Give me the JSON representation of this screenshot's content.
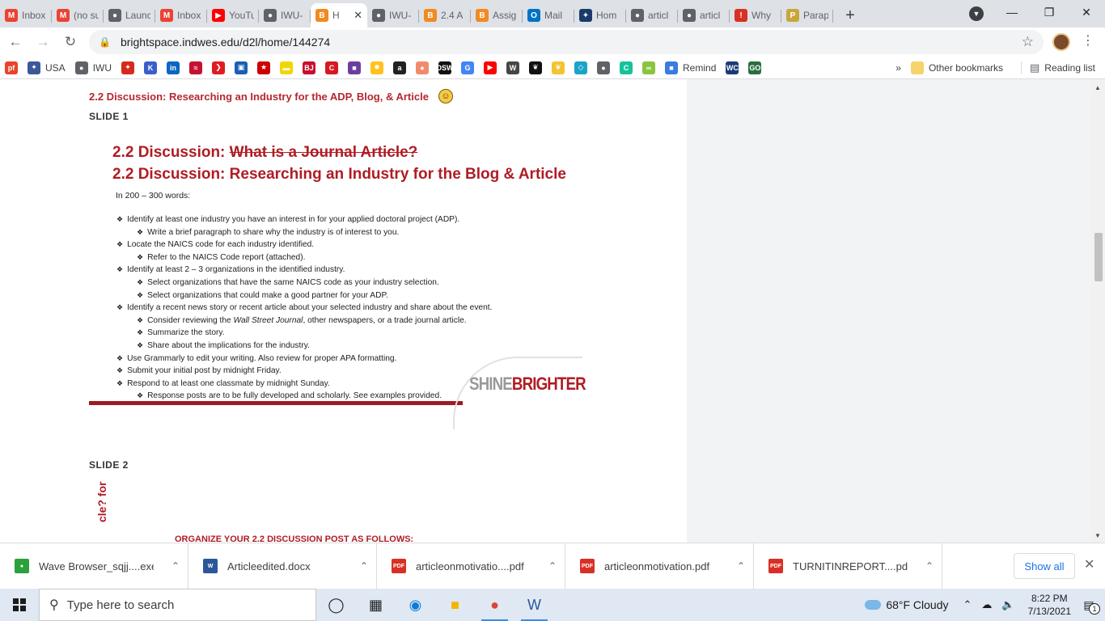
{
  "browser": {
    "tabs": [
      {
        "title": "Inbox",
        "icon": "gmail-icon",
        "color": "#ea4335",
        "glyph": "M"
      },
      {
        "title": "(no su",
        "icon": "gmail-icon",
        "color": "#ea4335",
        "glyph": "M"
      },
      {
        "title": "Launc",
        "icon": "globe-icon",
        "color": "#5f6368",
        "glyph": "●"
      },
      {
        "title": "Inbox",
        "icon": "gmail-icon",
        "color": "#ea4335",
        "glyph": "M"
      },
      {
        "title": "YouTu",
        "icon": "youtube-icon",
        "color": "#ff0000",
        "glyph": "▶"
      },
      {
        "title": "IWU-",
        "icon": "globe-icon",
        "color": "#5f6368",
        "glyph": "●"
      },
      {
        "title": "H",
        "icon": "brightspace-icon",
        "color": "#f18a21",
        "glyph": "B",
        "active": true
      },
      {
        "title": "IWU-",
        "icon": "globe-icon",
        "color": "#5f6368",
        "glyph": "●"
      },
      {
        "title": "2.4 A",
        "icon": "brightspace-icon",
        "color": "#f18a21",
        "glyph": "B"
      },
      {
        "title": "Assig",
        "icon": "brightspace-icon",
        "color": "#f18a21",
        "glyph": "B"
      },
      {
        "title": "Mail",
        "icon": "outlook-icon",
        "color": "#0072c6",
        "glyph": "O"
      },
      {
        "title": "Hom",
        "icon": "compass-icon",
        "color": "#1a3a6b",
        "glyph": "✦"
      },
      {
        "title": "articl",
        "icon": "globe-icon",
        "color": "#5f6368",
        "glyph": "●"
      },
      {
        "title": "articl",
        "icon": "globe-icon",
        "color": "#5f6368",
        "glyph": "●"
      },
      {
        "title": "Why",
        "icon": "exclaim-icon",
        "color": "#d93025",
        "glyph": "!"
      },
      {
        "title": "Parap",
        "icon": "quillbot-icon",
        "color": "#c8a63a",
        "glyph": "P"
      }
    ],
    "url": "brightspace.indwes.edu/d2l/home/144274",
    "bookmarks": [
      {
        "label": "",
        "icon": "pf-icon",
        "color": "#e8452c",
        "glyph": "pf"
      },
      {
        "label": "USA",
        "icon": "seal-icon",
        "color": "#3b5998",
        "glyph": "✦"
      },
      {
        "label": "IWU",
        "icon": "globe-icon",
        "color": "#5f6368",
        "glyph": "●"
      },
      {
        "label": "",
        "icon": "maple-leaf-icon",
        "color": "#d52b1e",
        "glyph": "✦"
      },
      {
        "label": "",
        "icon": "k-icon",
        "color": "#3a5fcd",
        "glyph": "K"
      },
      {
        "label": "",
        "icon": "linkedin-icon",
        "color": "#0a66c2",
        "glyph": "in"
      },
      {
        "label": "",
        "icon": "bank-icon",
        "color": "#c41230",
        "glyph": "≈"
      },
      {
        "label": "",
        "icon": "arrow-icon",
        "color": "#e11b22",
        "glyph": "❯"
      },
      {
        "label": "",
        "icon": "shield-icon",
        "color": "#1a5fb4",
        "glyph": "▣"
      },
      {
        "label": "",
        "icon": "star-icon",
        "color": "#cc0000",
        "glyph": "★"
      },
      {
        "label": "",
        "icon": "tag-icon",
        "color": "#f2d600",
        "glyph": "▬"
      },
      {
        "label": "",
        "icon": "bjs-icon",
        "color": "#c8102e",
        "glyph": "BJ"
      },
      {
        "label": "",
        "icon": "c-icon",
        "color": "#d71921",
        "glyph": "C"
      },
      {
        "label": "",
        "icon": "bag-icon",
        "color": "#6b3fa0",
        "glyph": "■"
      },
      {
        "label": "",
        "icon": "walmart-icon",
        "color": "#ffc220",
        "glyph": "✹"
      },
      {
        "label": "",
        "icon": "amazon-icon",
        "color": "#222222",
        "glyph": "a"
      },
      {
        "label": "",
        "icon": "peach-icon",
        "color": "#f28b6b",
        "glyph": "●"
      },
      {
        "label": "",
        "icon": "dsw-icon",
        "color": "#111111",
        "glyph": "DSW"
      },
      {
        "label": "",
        "icon": "google-icon",
        "color": "#4285f4",
        "glyph": "G"
      },
      {
        "label": "",
        "icon": "youtube-icon",
        "color": "#ff0000",
        "glyph": "▶"
      },
      {
        "label": "",
        "icon": "wordpress-icon",
        "color": "#464646",
        "glyph": "W"
      },
      {
        "label": "",
        "icon": "paw-icon",
        "color": "#111111",
        "glyph": "❦"
      },
      {
        "label": "",
        "icon": "paw-yellow-icon",
        "color": "#f4c430",
        "glyph": "❦"
      },
      {
        "label": "",
        "icon": "diamond-icon",
        "color": "#1aa3c8",
        "glyph": "◇"
      },
      {
        "label": "",
        "icon": "globe-icon",
        "color": "#5f6368",
        "glyph": "●"
      },
      {
        "label": "",
        "icon": "grammar-icon",
        "color": "#15c39a",
        "glyph": "C"
      },
      {
        "label": "",
        "icon": "chain-icon",
        "color": "#8ac43f",
        "glyph": "∞"
      },
      {
        "label": "Remind",
        "icon": "remind-icon",
        "color": "#3a7be0",
        "glyph": "■"
      },
      {
        "label": "",
        "icon": "wc-icon",
        "color": "#1b3a7a",
        "glyph": "WC"
      },
      {
        "label": "",
        "icon": "go-icon",
        "color": "#2a6e3f",
        "glyph": "GO"
      }
    ],
    "bookmarks_more": "»",
    "other_bookmarks": "Other bookmarks",
    "reading_list": "Reading list"
  },
  "page": {
    "discussion_title": "2.2 Discussion: Researching an Industry for the ADP, Blog, & Article",
    "slide1_label": "SLIDE 1",
    "slide": {
      "title_struck_prefix": "2.2 Discussion: ",
      "title_struck": "What is a Journal Article?",
      "title": "2.2 Discussion: Researching an Industry for the Blog & Article",
      "word_count": "In 200 – 300 words:",
      "bullets": [
        {
          "level": 1,
          "text": "Identify at least one industry you have an interest in for your applied doctoral project (ADP)."
        },
        {
          "level": 2,
          "text": "Write a brief paragraph to share why the industry is of interest to you."
        },
        {
          "level": 1,
          "text": "Locate the NAICS code for each industry identified."
        },
        {
          "level": 2,
          "text": "Refer to the NAICS Code report (attached)."
        },
        {
          "level": 1,
          "text": "Identify at least 2 – 3 organizations in the identified industry."
        },
        {
          "level": 2,
          "text": "Select organizations that have the same NAICS code as your industry selection."
        },
        {
          "level": 2,
          "text": "Select organizations that could make a good partner for your ADP."
        },
        {
          "level": 1,
          "text": "Identify a recent news story or recent article about your selected industry and share about the event."
        },
        {
          "level": 2,
          "text": "Consider reviewing the ",
          "italic": "Wall Street Journal",
          "after": ", other newspapers, or a trade journal article."
        },
        {
          "level": 2,
          "text": "Summarize the story."
        },
        {
          "level": 2,
          "text": "Share about the implications for the industry."
        },
        {
          "level": 1,
          "text": "Use Grammarly to edit your writing. Also review for proper APA formatting."
        },
        {
          "level": 1,
          "text": "Submit your initial post by midnight Friday."
        },
        {
          "level": 1,
          "text": "Respond to at least one classmate by midnight Sunday."
        },
        {
          "level": 2,
          "text": "Response posts are to be fully developed and scholarly. See examples provided."
        }
      ],
      "logo_shine": "SHINE",
      "logo_brighter": "BRIGHTER"
    },
    "slide2_label": "SLIDE 2",
    "slide2_side_text": "cle? for",
    "slide2_heading": "ORGANIZE YOUR 2.2 DISCUSSION POST AS FOLLOWS:"
  },
  "downloads": {
    "items": [
      {
        "name": "Wave Browser_sqjj....exe",
        "icon": "wave-icon",
        "color": "#2aa13c",
        "glyph": "●"
      },
      {
        "name": "Articleedited.docx",
        "icon": "word-doc-icon",
        "color": "#2b579a",
        "glyph": "W"
      },
      {
        "name": "articleonmotivatio....pdf",
        "icon": "pdf-icon",
        "color": "#d93025",
        "glyph": "PDF"
      },
      {
        "name": "articleonmotivation.pdf",
        "icon": "pdf-icon",
        "color": "#d93025",
        "glyph": "PDF"
      },
      {
        "name": "TURNITINREPORT....pdf",
        "icon": "pdf-icon",
        "color": "#d93025",
        "glyph": "PDF"
      }
    ],
    "show_all": "Show all"
  },
  "taskbar": {
    "search_placeholder": "Type here to search",
    "weather": "68°F  Cloudy",
    "time": "8:22 PM",
    "date": "7/13/2021",
    "notification_count": "1"
  }
}
